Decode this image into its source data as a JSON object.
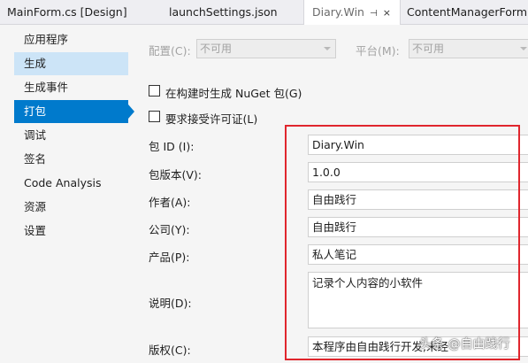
{
  "tabs": [
    {
      "label": "MainForm.cs [Design]"
    },
    {
      "label": "launchSettings.json"
    },
    {
      "label": "Diary.Win",
      "pin": "⊣",
      "close": "×"
    },
    {
      "label": "ContentManagerForm.cs"
    }
  ],
  "sidebar": {
    "items": [
      {
        "label": "应用程序"
      },
      {
        "label": "生成"
      },
      {
        "label": "生成事件"
      },
      {
        "label": "打包"
      },
      {
        "label": "调试"
      },
      {
        "label": "签名"
      },
      {
        "label": "Code Analysis"
      },
      {
        "label": "资源"
      },
      {
        "label": "设置"
      }
    ]
  },
  "config": {
    "config_label": "配置(C):",
    "config_value": "不可用",
    "platform_label": "平台(M):",
    "platform_value": "不可用"
  },
  "checkboxes": {
    "build_nuget": "在构建时生成 NuGet 包(G)",
    "require_license": "要求接受许可证(L)"
  },
  "package": {
    "id_label": "包 ID (I):",
    "id_value": "Diary.Win",
    "version_label": "包版本(V):",
    "version_value": "1.0.0",
    "authors_label": "作者(A):",
    "authors_value": "自由践行",
    "company_label": "公司(Y):",
    "company_value": "自由践行",
    "product_label": "产品(P):",
    "product_value": "私人笔记",
    "description_label": "说明(D):",
    "description_value": "记录个人内容的小软件",
    "copyright_label": "版权(C):",
    "copyright_value": "本程序由自由践行开发,未经"
  },
  "watermark": "头条 @自由践行",
  "colors": {
    "accent": "#007acc",
    "highlight_box": "#e0262d"
  }
}
